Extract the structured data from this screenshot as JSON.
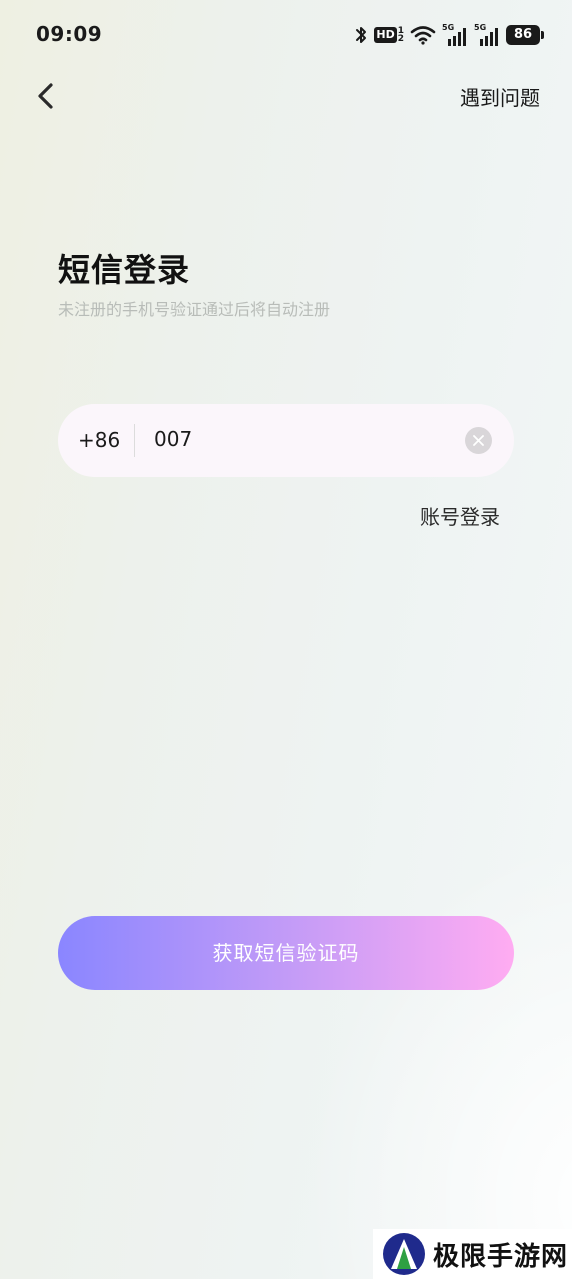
{
  "status_bar": {
    "time": "09:09",
    "hd_label": "HD",
    "hd_sup": "1",
    "hd_sub": "2",
    "network_label_1": "5G",
    "network_label_2": "5G",
    "battery": "86",
    "icons": [
      "bluetooth-icon",
      "hd-icon",
      "wifi-icon",
      "signal-5g-icon",
      "signal-5g-icon",
      "battery-icon"
    ]
  },
  "nav": {
    "back_icon": "chevron-left-icon",
    "help_label": "遇到问题"
  },
  "header": {
    "title": "短信登录",
    "subtitle": "未注册的手机号验证通过后将自动注册"
  },
  "phone": {
    "country_code": "+86",
    "value": "007",
    "clear_icon": "clear-circle-icon"
  },
  "links": {
    "account_login": "账号登录"
  },
  "actions": {
    "get_code_label": "获取短信验证码"
  },
  "watermark": {
    "text": "极限手游网"
  },
  "colors": {
    "button_gradient_start": "#8a86ff",
    "button_gradient_end": "#ffacf2",
    "input_background": "#fbf6fb",
    "subtitle": "#b8bcb8"
  }
}
